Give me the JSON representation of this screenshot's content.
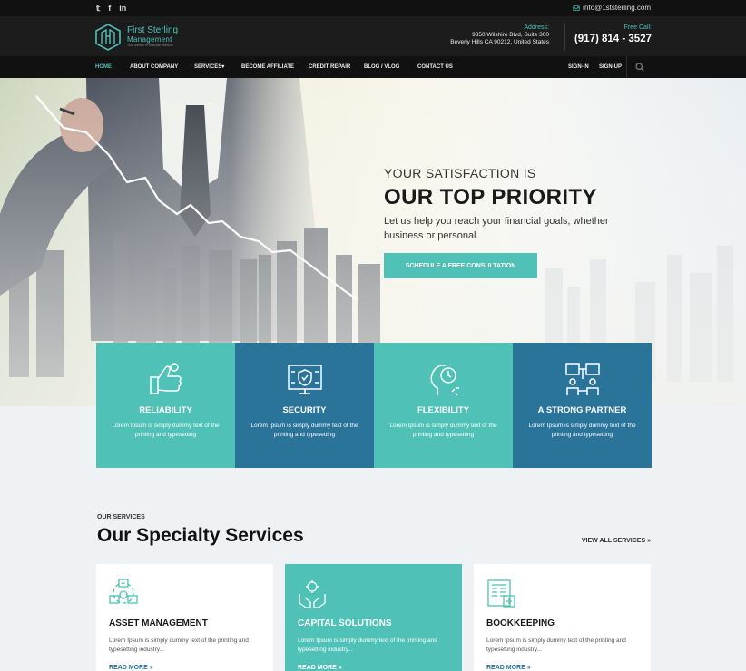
{
  "colors": {
    "accent": "#4fc1b6",
    "accent_dark": "#2a7399",
    "topbar": "#111111",
    "header": "#1c1c1c"
  },
  "topbar": {
    "social_icons": [
      "twitter-icon",
      "facebook-icon",
      "linkedin-icon"
    ],
    "social": [
      "𝕥",
      "f",
      "in"
    ],
    "email": "info@1ststerling.com"
  },
  "header": {
    "logo_name": "First Sterling",
    "logo_name2": "Management",
    "logo_tagline": "Your advisor in financial freedom",
    "address_label": "Address:",
    "address_line1": "9350 Wilshire Blvd, Suite 300",
    "address_line2": "Beverly Hills CA 90212, United States",
    "call_label": "Free Call:",
    "phone": "(917) 814 - 3527"
  },
  "nav": {
    "items": [
      "HOME",
      "ABOUT COMPANY",
      "SERVICES▾",
      "BECOME AFFILIATE",
      "CREDIT REPAIR",
      "BLOG / VLOG",
      "CONTACT US"
    ],
    "signin": "SIGN-IN",
    "separator": "|",
    "signup": "SIGN-UP"
  },
  "hero": {
    "small_title": "YOUR SATISFACTION IS",
    "big_title": "OUR TOP PRIORITY",
    "subtitle": "Let us help you reach your financial goals, whether business or personal.",
    "button": "SCHEDULE A FREE CONSULTATION"
  },
  "features": [
    {
      "title": "RELIABILITY",
      "text": "Lorem Ipsum is simply dummy text of the printing and typesetting",
      "icon": "thumbs-up-icon"
    },
    {
      "title": "SECURITY",
      "text": "Lorem Ipsum is simply dummy text of the printing and typesetting",
      "icon": "shield-monitor-icon"
    },
    {
      "title": "FLEXIBILITY",
      "text": "Lorem Ipsum is simply dummy text of the printing and typesetting",
      "icon": "head-clock-icon"
    },
    {
      "title": "A STRONG PARTNER",
      "text": "Lorem Ipsum is simply dummy text of the printing and typesetting",
      "icon": "partners-icon"
    }
  ],
  "services": {
    "label": "OUR SERVICES",
    "title": "Our Specialty Services",
    "view_all": "VIEW ALL SERVICES »",
    "cards": [
      {
        "title": "ASSET MANAGEMENT",
        "text": "Lorem Ipsum is simply dummy text of the printing and typesetting industry...",
        "link": "READ MORE »",
        "icon": "asset-cycle-icon"
      },
      {
        "title": "CAPITAL SOLUTIONS",
        "text": "Lorem Ipsum is simply dummy text of the printing and typesetting industry...",
        "link": "READ MORE »",
        "icon": "hands-gear-icon"
      },
      {
        "title": "BOOKKEEPING",
        "text": "Lorem Ipsum is simply dummy text of the printing and typesetting industry...",
        "link": "READ MORE »",
        "icon": "ledger-icon"
      }
    ]
  }
}
